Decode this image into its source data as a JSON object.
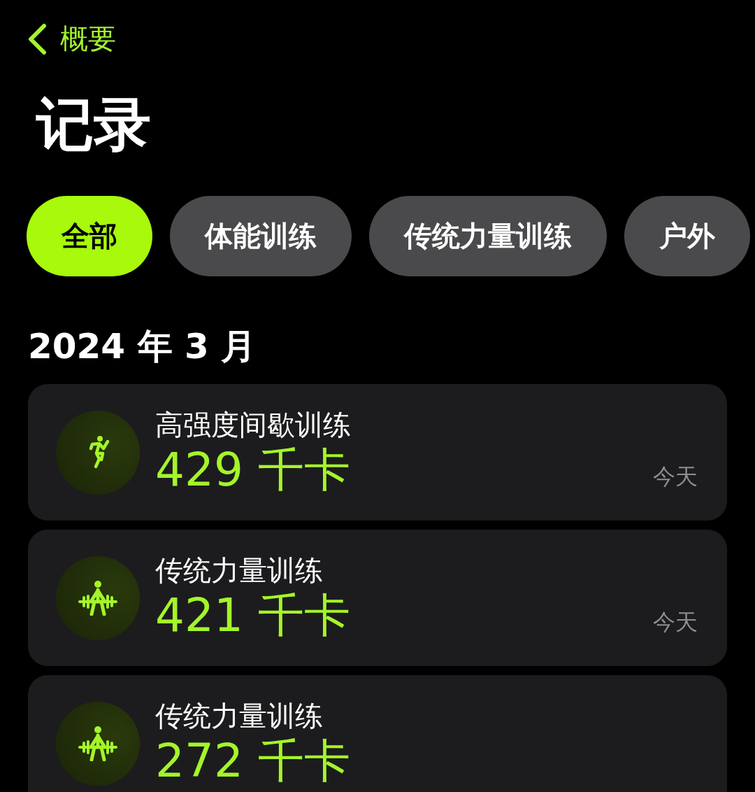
{
  "nav": {
    "back_label": "概要"
  },
  "title": "记录",
  "filters": [
    {
      "label": "全部",
      "selected": true
    },
    {
      "label": "体能训练",
      "selected": false
    },
    {
      "label": "传统力量训练",
      "selected": false
    },
    {
      "label": "户外",
      "selected": false
    }
  ],
  "sections": [
    {
      "heading": "2024 年 3 月",
      "workouts": [
        {
          "kind": "hiit",
          "name": "高强度间歇训练",
          "calories": "429 千卡",
          "date": "今天"
        },
        {
          "kind": "strength",
          "name": "传统力量训练",
          "calories": "421 千卡",
          "date": "今天"
        },
        {
          "kind": "strength",
          "name": "传统力量训练",
          "calories": "272 千卡"
        }
      ]
    }
  ]
}
